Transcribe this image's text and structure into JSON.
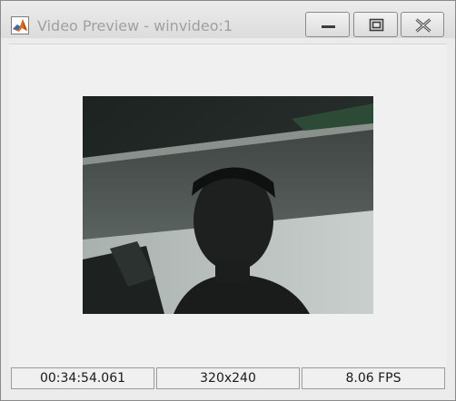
{
  "window": {
    "title": "Video Preview - winvideo:1",
    "icons": {
      "app": "matlab-logo-icon",
      "minimize": "minimize-icon",
      "maximize": "maximize-icon",
      "close": "close-icon"
    }
  },
  "status": {
    "timestamp": "00:34:54.061",
    "resolution": "320x240",
    "frame_rate": "8.06 FPS"
  }
}
